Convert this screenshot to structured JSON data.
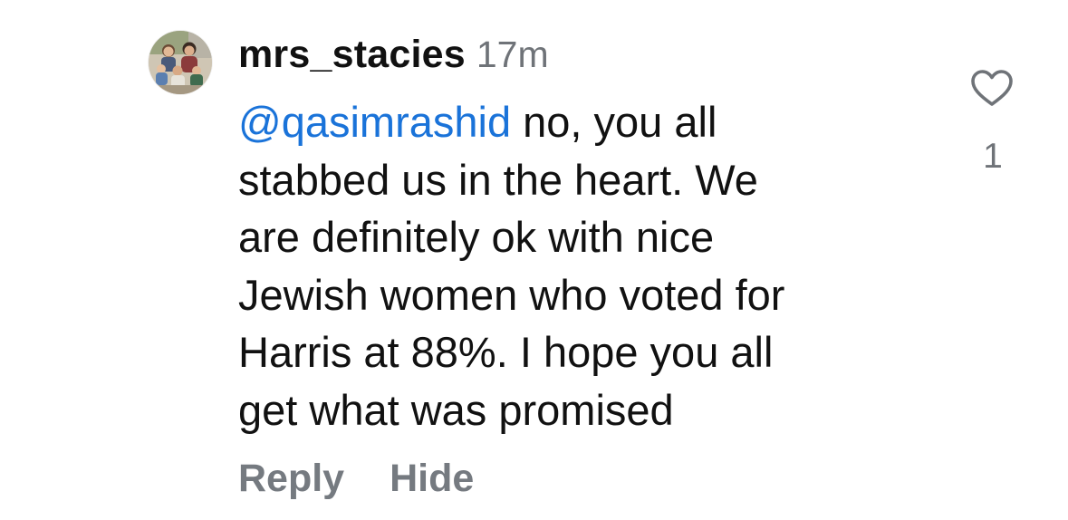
{
  "comment": {
    "username": "mrs_stacies",
    "timestamp": "17m",
    "mention": "@qasimrashid",
    "lines": [
      " no, you all",
      "stabbed us in the heart. We",
      "are definitely ok with nice",
      "Jewish women who voted for",
      "Harris at 88%. I hope you all",
      "get what was promised"
    ],
    "like_count": "1",
    "avatar_icon": "profile-photo",
    "like_icon": "heart-outline-icon"
  },
  "actions": {
    "reply_label": "Reply",
    "hide_label": "Hide"
  },
  "colors": {
    "text": "#111111",
    "mention": "#1a73d9",
    "secondary": "#6f7378",
    "action": "#757a80"
  }
}
